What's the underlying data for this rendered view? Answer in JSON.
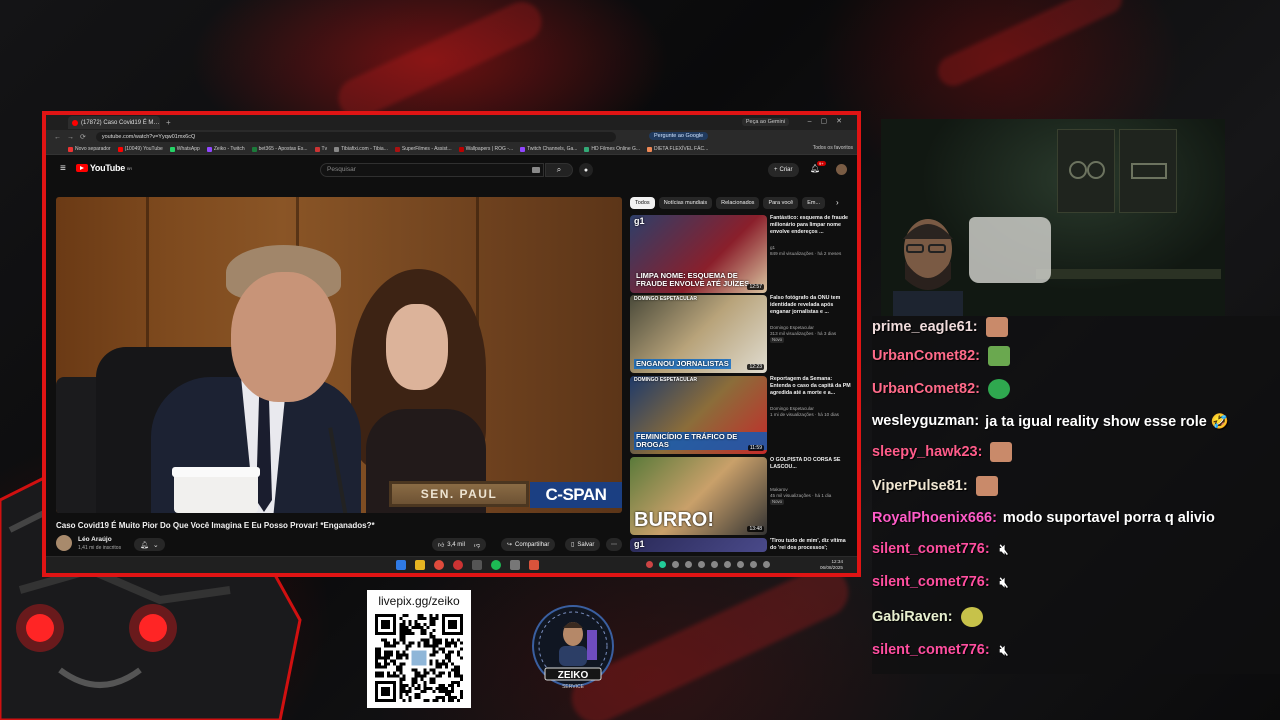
{
  "browser": {
    "tab_title": "(17872) Caso Covid19 É M…",
    "gemini_label": "Peça ao Gemini",
    "url": "youtube.com/watch?v=Yyqw01mx6cQ",
    "ask_google": "Pergunte ao Google",
    "bookmarks": [
      "Novo separador",
      "(10049) YouTube",
      "WhatsApp",
      "Zeiko - Twitch",
      "bet365 - Apostas Es...",
      "Tv",
      "Tibiafixi.com - Tibia...",
      "SuperFilmes - Assist...",
      "Wallpapers | ROG -...",
      "Twitch Channels, Ga...",
      "HD Filmes Online G...",
      "DIETA FLEXÍVEL FÁC..."
    ],
    "bookmarks_all": "Todos os favoritos"
  },
  "youtube": {
    "logo": "YouTube",
    "logo_region": "BR",
    "search_placeholder": "Pesquisar",
    "create_label": "Criar",
    "notif_count": "9+",
    "nameplate": "SEN. PAUL",
    "cspan": "C-SPAN",
    "video_title": "Caso Covid19 É Muito Pior Do Que Você Imagina E Eu Posso Provar! *Enganados?*",
    "channel_name": "Léo Araújo",
    "channel_subs": "1,41 mi de inscritos",
    "likes": "3,4 mil",
    "share_label": "Compartilhar",
    "save_label": "Salvar",
    "chips": [
      "Todos",
      "Notícias mundiais",
      "Relacionados",
      "Para você",
      "Em..."
    ],
    "recommendations": [
      {
        "title": "Fantástico: esquema de fraude milionário para limpar nome envolve endereços ...",
        "channel": "g1",
        "meta": "849 mil visualizações · há 2 meses",
        "duration": "12:57",
        "overlay": "LIMPA NOME: ESQUEMA DE FRAUDE ENVOLVE ATÉ JUÍZES",
        "brand": "g1",
        "badge": ""
      },
      {
        "title": "Falso fotógrafo da ONU tem identidade revelada após enganar jornalistas e ...",
        "channel": "Domingo Espetacular",
        "meta": "313 mil visualizações · há 3 dias",
        "duration": "12:23",
        "overlay": "ENGANOU JORNALISTAS",
        "brand": "DOMINGO ESPETACULAR",
        "badge": "Novo"
      },
      {
        "title": "Reportagem da Semana: Entenda o caso da capitã da PM agredida até a morte e a...",
        "channel": "Domingo Espetacular",
        "meta": "1 mi de visualizações · há 10 dias",
        "duration": "11:59",
        "overlay": "FEMINICÍDIO E TRÁFICO DE DROGAS",
        "brand": "DOMINGO ESPETACULAR",
        "badge": ""
      },
      {
        "title": "O GOLPISTA DO CORSA SE LASCOU...",
        "channel": "Makarov",
        "meta": "45 mil visualizações · há 1 dia",
        "duration": "13:48",
        "overlay": "BURRO!",
        "brand": "",
        "badge": "Novo"
      },
      {
        "title": "'Tirou tudo de mim', diz vítima do 'rei dos processos';",
        "channel": "",
        "meta": "",
        "duration": "",
        "overlay": "",
        "brand": "g1",
        "badge": ""
      }
    ]
  },
  "taskbar": {
    "time": "12:34",
    "date": "06/08/2025"
  },
  "chat": [
    {
      "user": "prime_eagle61:",
      "text": "",
      "color": "#f0dcdc",
      "emote": "face"
    },
    {
      "user": "UrbanComet82:",
      "text": "",
      "color": "#ff6b8a",
      "emote": "frog"
    },
    {
      "user": "UrbanComet82:",
      "text": "",
      "color": "#ff6b8a",
      "emote": "globe"
    },
    {
      "user": "wesleyguzman:",
      "text": "ja ta igual reality show esse role 🤣",
      "color": "#ffffff",
      "emote": ""
    },
    {
      "user": "sleepy_hawk23:",
      "text": "",
      "color": "#ff5c8a",
      "emote": "face"
    },
    {
      "user": "ViperPulse81:",
      "text": "",
      "color": "#f0e6d2",
      "emote": "face"
    },
    {
      "user": "RoyalPhoenix666:",
      "text": "modo suportavel porra q alivio",
      "color": "#ff5cc8",
      "emote": ""
    },
    {
      "user": "silent_comet776:",
      "text": "",
      "color": "#ff4fa0",
      "emote": "speaker"
    },
    {
      "user": "silent_comet776:",
      "text": "",
      "color": "#ff4fa0",
      "emote": "speaker"
    },
    {
      "user": "GabiRaven:",
      "text": "",
      "color": "#e8f0d0",
      "emote": "bird"
    },
    {
      "user": "silent_comet776:",
      "text": "",
      "color": "#ff4fa0",
      "emote": "speaker"
    }
  ],
  "overlay": {
    "qr_label": "livepix.gg/zeiko",
    "logo_text": "ZEIKO",
    "logo_sub": "SERVICE"
  },
  "colors": {
    "frame_red": "#e01414",
    "yt_red": "#ff0000",
    "cspan_blue": "#1b3f82"
  }
}
